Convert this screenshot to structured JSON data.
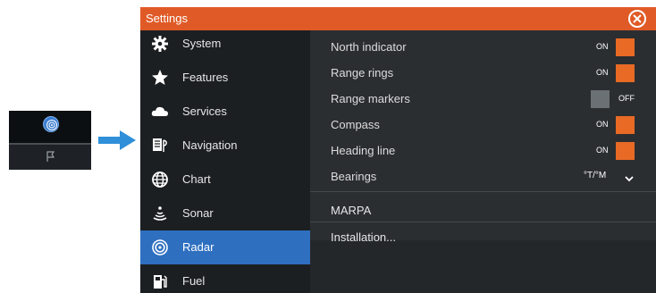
{
  "window": {
    "title": "Settings",
    "close_icon": "close-icon"
  },
  "sidebar": {
    "items": [
      {
        "label": "System",
        "icon": "gear-icon"
      },
      {
        "label": "Features",
        "icon": "star-icon"
      },
      {
        "label": "Services",
        "icon": "cloud-icon"
      },
      {
        "label": "Navigation",
        "icon": "navigation-icon"
      },
      {
        "label": "Chart",
        "icon": "globe-icon"
      },
      {
        "label": "Sonar",
        "icon": "sonar-icon"
      },
      {
        "label": "Radar",
        "icon": "radar-icon",
        "active": true
      },
      {
        "label": "Fuel",
        "icon": "fuel-icon"
      }
    ]
  },
  "radar": {
    "rows": [
      {
        "label": "North indicator",
        "state": "ON"
      },
      {
        "label": "Range rings",
        "state": "ON"
      },
      {
        "label": "Range markers",
        "state": "OFF"
      },
      {
        "label": "Compass",
        "state": "ON"
      },
      {
        "label": "Heading line",
        "state": "ON"
      }
    ],
    "bearings": {
      "label": "Bearings",
      "value": "°T/°M"
    },
    "marpa_label": "MARPA",
    "installation_label": "Installation..."
  },
  "colors": {
    "titlebar": "#e05a27",
    "toggle_on": "#e86a25",
    "active_item": "#2e6fc0",
    "arrow": "#2f8fd8"
  }
}
